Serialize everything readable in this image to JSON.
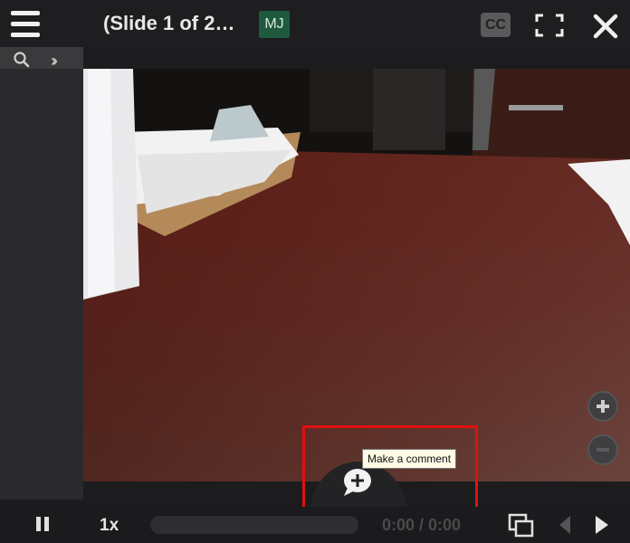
{
  "header": {
    "title": "(Slide 1 of 2…",
    "avatar_initials": "MJ",
    "cc_label": "CC"
  },
  "icons": {
    "menu": "hamburger-menu-icon",
    "search": "search-icon",
    "expand": "double-chevron-right-icon",
    "fullscreen": "fullscreen-icon",
    "close": "close-icon",
    "zoom_in": "plus-icon",
    "zoom_out": "minus-icon",
    "comment": "add-comment-icon",
    "pause": "pause-icon",
    "slides": "slides-icon",
    "prev": "prev-icon",
    "next": "next-icon"
  },
  "comment": {
    "tooltip": "Make a comment"
  },
  "controls": {
    "speed": "1x",
    "time": "0:00 / 0:00"
  },
  "colors": {
    "avatar_bg": "#1f5a3f",
    "highlight": "#e11010",
    "tooltip_bg": "#fffbe6"
  }
}
